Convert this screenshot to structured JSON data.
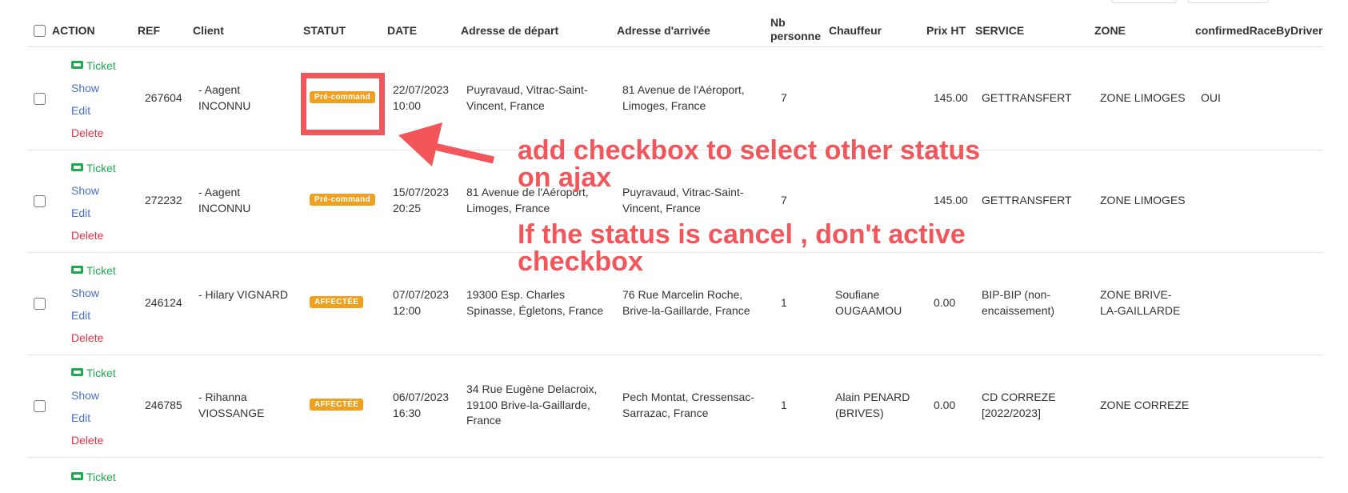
{
  "columns": {
    "action": "ACTION",
    "ref": "REF",
    "client": "Client",
    "statut": "STATUT",
    "date": "DATE",
    "depart": "Adresse de départ",
    "arrivee": "Adresse d'arrivée",
    "nb_line1": "Nb",
    "nb_line2": "personne",
    "chauffeur": "Chauffeur",
    "prix": "Prix HT",
    "service": "SERVICE",
    "zone": "ZONE",
    "confirmed": "confirmedRaceByDriver"
  },
  "actions": {
    "ticket": "Ticket",
    "show": "Show",
    "edit": "Edit",
    "delete": "Delete"
  },
  "rows": [
    {
      "ref": "267604",
      "client1": "- Aagent",
      "client2": "INCONNU",
      "statut": "Pré-command",
      "date1": "22/07/2023",
      "date2": "10:00",
      "dep1": "Puyravaud, Vitrac-Saint-",
      "dep2": "Vincent, France",
      "dep3": "",
      "arr1": "81 Avenue de l'Aéroport,",
      "arr2": "Limoges, France",
      "nb": "7",
      "ch1": "",
      "ch2": "",
      "prix": "145.00",
      "serv1": "GETTRANSFERT",
      "serv2": "",
      "zone1": "ZONE LIMOGES",
      "zone2": "",
      "confirmed": "OUI"
    },
    {
      "ref": "272232",
      "client1": "- Aagent",
      "client2": "INCONNU",
      "statut": "Pré-command",
      "date1": "15/07/2023",
      "date2": "20:25",
      "dep1": "81 Avenue de l'Aéroport,",
      "dep2": "Limoges, France",
      "dep3": "",
      "arr1": "Puyravaud, Vitrac-Saint-",
      "arr2": "Vincent, France",
      "nb": "7",
      "ch1": "",
      "ch2": "",
      "prix": "145.00",
      "serv1": "GETTRANSFERT",
      "serv2": "",
      "zone1": "ZONE LIMOGES",
      "zone2": "",
      "confirmed": ""
    },
    {
      "ref": "246124",
      "client1": "- Hilary VIGNARD",
      "client2": "",
      "statut": "AFFECTÉE",
      "date1": "07/07/2023",
      "date2": "12:00",
      "dep1": "19300 Esp. Charles",
      "dep2": "Spinasse, Égletons, France",
      "dep3": "",
      "arr1": "76 Rue Marcelin Roche,",
      "arr2": "Brive-la-Gaillarde, France",
      "nb": "1",
      "ch1": "Soufiane",
      "ch2": "OUGAAMOU",
      "prix": "0.00",
      "serv1": "BIP-BIP (non-",
      "serv2": "encaissement)",
      "zone1": "ZONE BRIVE-",
      "zone2": "LA-GAILLARDE",
      "confirmed": ""
    },
    {
      "ref": "246785",
      "client1": "- Rihanna",
      "client2": "VIOSSANGE",
      "statut": "AFFECTÉE",
      "date1": "06/07/2023",
      "date2": "16:30",
      "dep1": "34 Rue Eugène Delacroix,",
      "dep2": "19100 Brive-la-Gaillarde,",
      "dep3": "France",
      "arr1": "Pech Montat, Cressensac-",
      "arr2": "Sarrazac, France",
      "nb": "1",
      "ch1": "Alain PENARD",
      "ch2": "(BRIVES)",
      "prix": "0.00",
      "serv1": "CD CORREZE",
      "serv2": "[2022/2023]",
      "zone1": "ZONE CORREZE",
      "zone2": "",
      "confirmed": ""
    }
  ],
  "annotation": {
    "line1": "add checkbox to select other status",
    "line2": "on ajax",
    "line3": "If the status is cancel , don't active",
    "line4": "checkbox"
  },
  "colors": {
    "accent_red": "#f2565a",
    "badge_orange": "#f0a01f",
    "ticket_green": "#1ea84f",
    "link_blue": "#4a6fd4",
    "delete_red": "#d9344a"
  }
}
